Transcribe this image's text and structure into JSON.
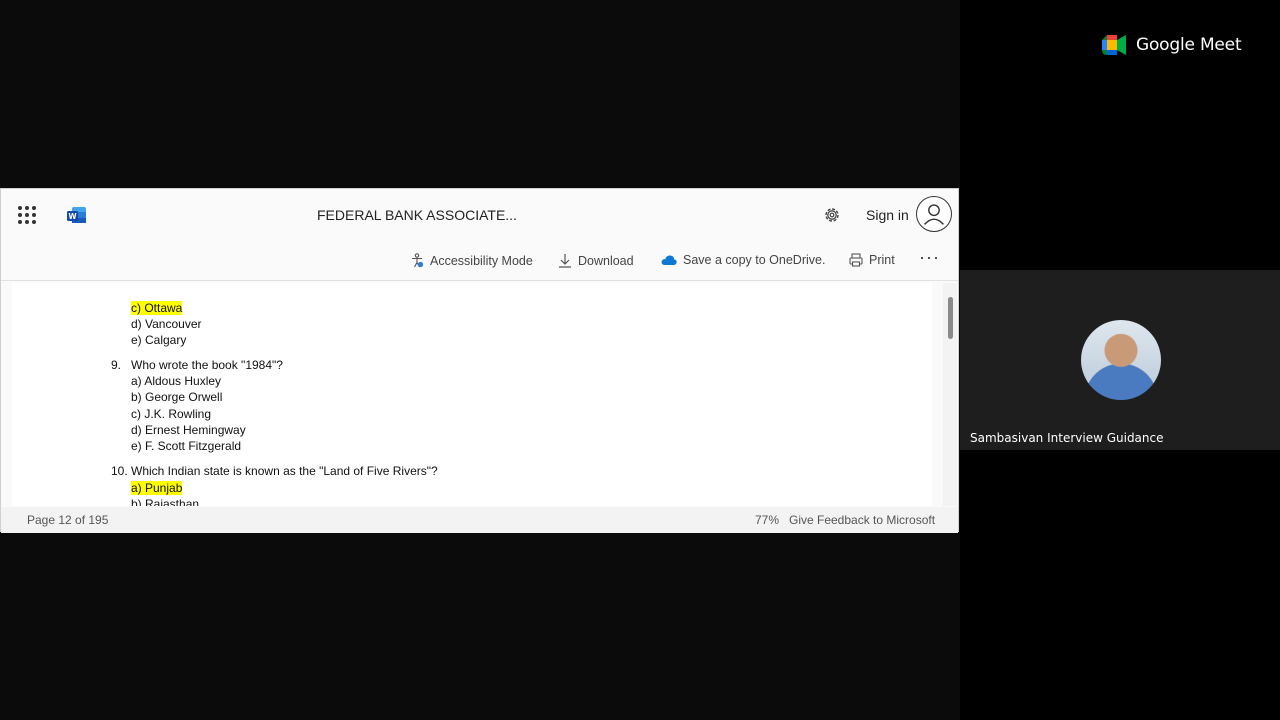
{
  "meet": {
    "logo_text": "Google Meet",
    "participant_name": "Sambasivan Interview Guidance"
  },
  "viewer": {
    "doc_title": "FEDERAL BANK ASSOCIATE...",
    "sign_in": "Sign in",
    "toolbar": {
      "accessibility": "Accessibility Mode",
      "download": "Download",
      "save_copy": "Save a copy to OneDrive.",
      "print": "Print",
      "more": "···"
    },
    "status": {
      "page": "Page 12 of 195",
      "zoom": "77%",
      "feedback": "Give Feedback to Microsoft"
    }
  },
  "document": {
    "q8_options": [
      {
        "text": "c) Ottawa",
        "highlight": true
      },
      {
        "text": "d) Vancouver",
        "highlight": false
      },
      {
        "text": "e) Calgary",
        "highlight": false
      }
    ],
    "q9": {
      "number": "9.",
      "question": "Who wrote the book \"1984\"?",
      "options": [
        {
          "text": "a) Aldous Huxley",
          "highlight": false
        },
        {
          "text": "b) George Orwell",
          "highlight": false
        },
        {
          "text": "c) J.K. Rowling",
          "highlight": false
        },
        {
          "text": "d) Ernest Hemingway",
          "highlight": false
        },
        {
          "text": "e) F. Scott Fitzgerald",
          "highlight": false
        }
      ]
    },
    "q10": {
      "number": "10.",
      "question": "Which Indian state is known as the \"Land of Five Rivers\"?",
      "options": [
        {
          "text": "a) Punjab",
          "highlight": true
        },
        {
          "text": "b) Rajasthan",
          "highlight": false
        }
      ]
    }
  }
}
